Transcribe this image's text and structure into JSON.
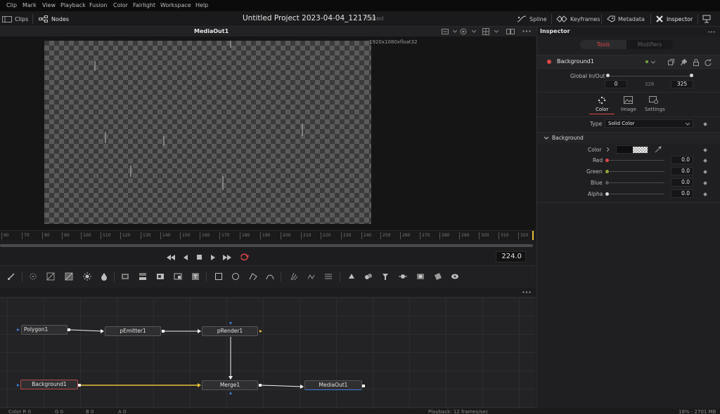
{
  "menu": [
    "Clip",
    "Mark",
    "View",
    "Playback",
    "Fusion",
    "Color",
    "Fairlight",
    "Workspace",
    "Help"
  ],
  "titlebar": {
    "clips_label": "Clips",
    "nodes_label": "Nodes",
    "project_title": "Untitled Project 2023-04-04_121751",
    "project_status": "Edited",
    "spline_label": "Spline",
    "keyframes_label": "Keyframes",
    "metadata_label": "Metadata",
    "inspector_label": "Inspector"
  },
  "viewer": {
    "title": "MediaOut1",
    "resolution": "1920x1080xfloat32",
    "ruler_ticks": [
      "60",
      "70",
      "80",
      "90",
      "100",
      "110",
      "120",
      "130",
      "140",
      "150",
      "160",
      "170",
      "180",
      "190",
      "200",
      "210",
      "220",
      "230",
      "240",
      "250",
      "260",
      "270",
      "280",
      "290",
      "300",
      "310",
      "320"
    ],
    "current_frame": "224.0"
  },
  "nodes": {
    "polygon": "Polygon1",
    "emitter": "pEmitter1",
    "render": "pRender1",
    "background": "Background1",
    "merge": "Merge1",
    "mediaout": "MediaOut1"
  },
  "inspector": {
    "title": "Inspector",
    "tabs": {
      "tools": "Tools",
      "modifiers": "Modifiers"
    },
    "node_name": "Background1",
    "global_inout_label": "Global In/Out",
    "global_in": "0",
    "global_mid": "326",
    "global_out": "325",
    "subtabs": [
      "Color",
      "Image",
      "Settings"
    ],
    "type_label": "Type",
    "type_value": "Solid Color",
    "section_label": "Background",
    "color_label": "Color",
    "channels": [
      {
        "label": "Red",
        "value": "0.0"
      },
      {
        "label": "Green",
        "value": "0.0"
      },
      {
        "label": "Blue",
        "value": "0.0"
      },
      {
        "label": "Alpha",
        "value": "0.0"
      }
    ]
  },
  "status": {
    "color_r": "Color R 0",
    "color_g": "G 0",
    "color_b": "B 0",
    "color_a": "A 0",
    "playback": "Playback: 12 frames/sec",
    "memory": "18% - 2701 MB"
  },
  "colors": {
    "accent_red": "#e04848",
    "edge_yellow": "#e8c038",
    "edge_white": "#f2f2f2",
    "node_selected_border": "#b54a4a"
  }
}
